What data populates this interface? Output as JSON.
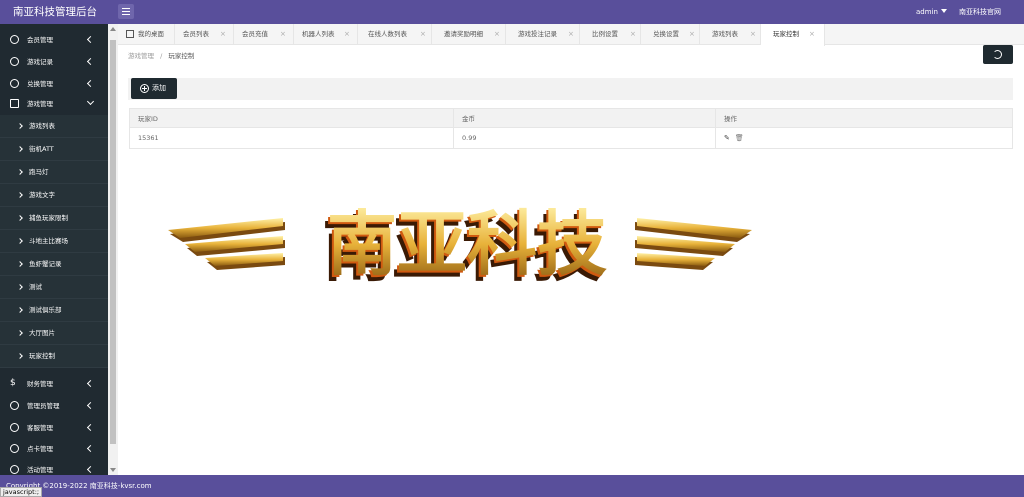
{
  "app": {
    "brand": "南亚科技管理后台"
  },
  "header": {
    "user": "admin",
    "site_link": "南亚科技官网"
  },
  "sidebar": {
    "items": [
      {
        "label": "会员管理"
      },
      {
        "label": "游戏记录"
      },
      {
        "label": "兑换管理"
      },
      {
        "label": "游戏管理"
      }
    ],
    "sub_items": [
      {
        "label": "游戏列表"
      },
      {
        "label": "街机ATT"
      },
      {
        "label": "跑马灯"
      },
      {
        "label": "游戏文字"
      },
      {
        "label": "捕鱼玩家限制"
      },
      {
        "label": "斗地主比赛场"
      },
      {
        "label": "鱼虾蟹记录"
      },
      {
        "label": "测试"
      },
      {
        "label": "测试俱乐部"
      },
      {
        "label": "大厅图片"
      },
      {
        "label": "玩家控制"
      }
    ],
    "bottom_items": [
      {
        "label": "财务管理"
      },
      {
        "label": "管理员管理"
      },
      {
        "label": "客服管理"
      },
      {
        "label": "点卡管理"
      },
      {
        "label": "活动管理"
      }
    ]
  },
  "tabs": [
    {
      "label": "我的桌面"
    },
    {
      "label": "会员列表"
    },
    {
      "label": "会员充值"
    },
    {
      "label": "机器人列表"
    },
    {
      "label": "在线人数列表"
    },
    {
      "label": "邀请奖励明细"
    },
    {
      "label": "游戏投注记录"
    },
    {
      "label": "比例设置"
    },
    {
      "label": "兑换设置"
    },
    {
      "label": "游戏列表"
    },
    {
      "label": "玩家控制"
    }
  ],
  "breadcrumb": {
    "parent": "游戏管理",
    "separator": "/",
    "current": "玩家控制"
  },
  "toolbar": {
    "add_label": "添加"
  },
  "table": {
    "headers": [
      "玩家ID",
      "金币",
      "操作"
    ],
    "rows": [
      {
        "player_id": "15361",
        "coins": "0.99"
      }
    ]
  },
  "logo": {
    "text": "南亚科技"
  },
  "footer": {
    "copyright": "Copyright ©2019-2022 南亚科技-kvsr.com"
  },
  "status_tip": "javascript:;",
  "colors": {
    "header": "#594f9b",
    "sidebar": "#202a31",
    "button": "#1f2a30",
    "logo_gold": "#e8b23a"
  }
}
